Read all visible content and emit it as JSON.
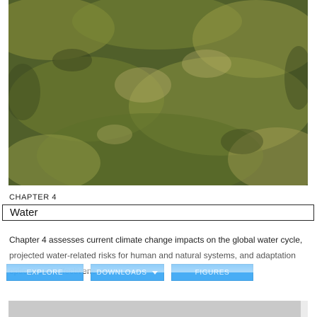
{
  "chapter": {
    "eyebrow": "CHAPTER 4",
    "title": "Water",
    "description": "Chapter 4 assesses current climate change impacts on the global water cycle, projected water-related risks for human and natural systems, and adaptation options and effectiveness."
  },
  "actions": {
    "explore_label": "EXPLORE",
    "downloads_label": "DOWNLOADS",
    "figures_label": "FIGURES"
  },
  "colors": {
    "button_bg": "#3fa9f5",
    "button_text": "#eaf6ff",
    "title_border": "#2a2a2a"
  },
  "icons": {
    "downloads_dropdown": "chevron-down-icon"
  }
}
